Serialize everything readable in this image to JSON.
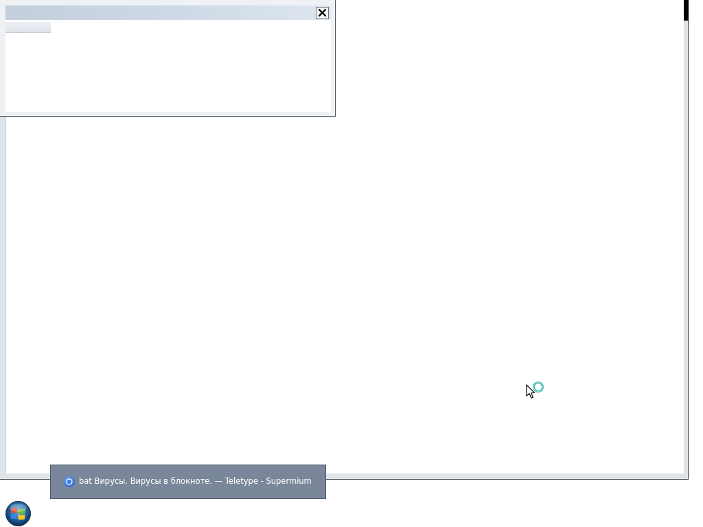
{
  "taskbar_preview": {
    "title": "bat Вирусы. Вирусы в блокноте. — Teletype - Supermium"
  }
}
